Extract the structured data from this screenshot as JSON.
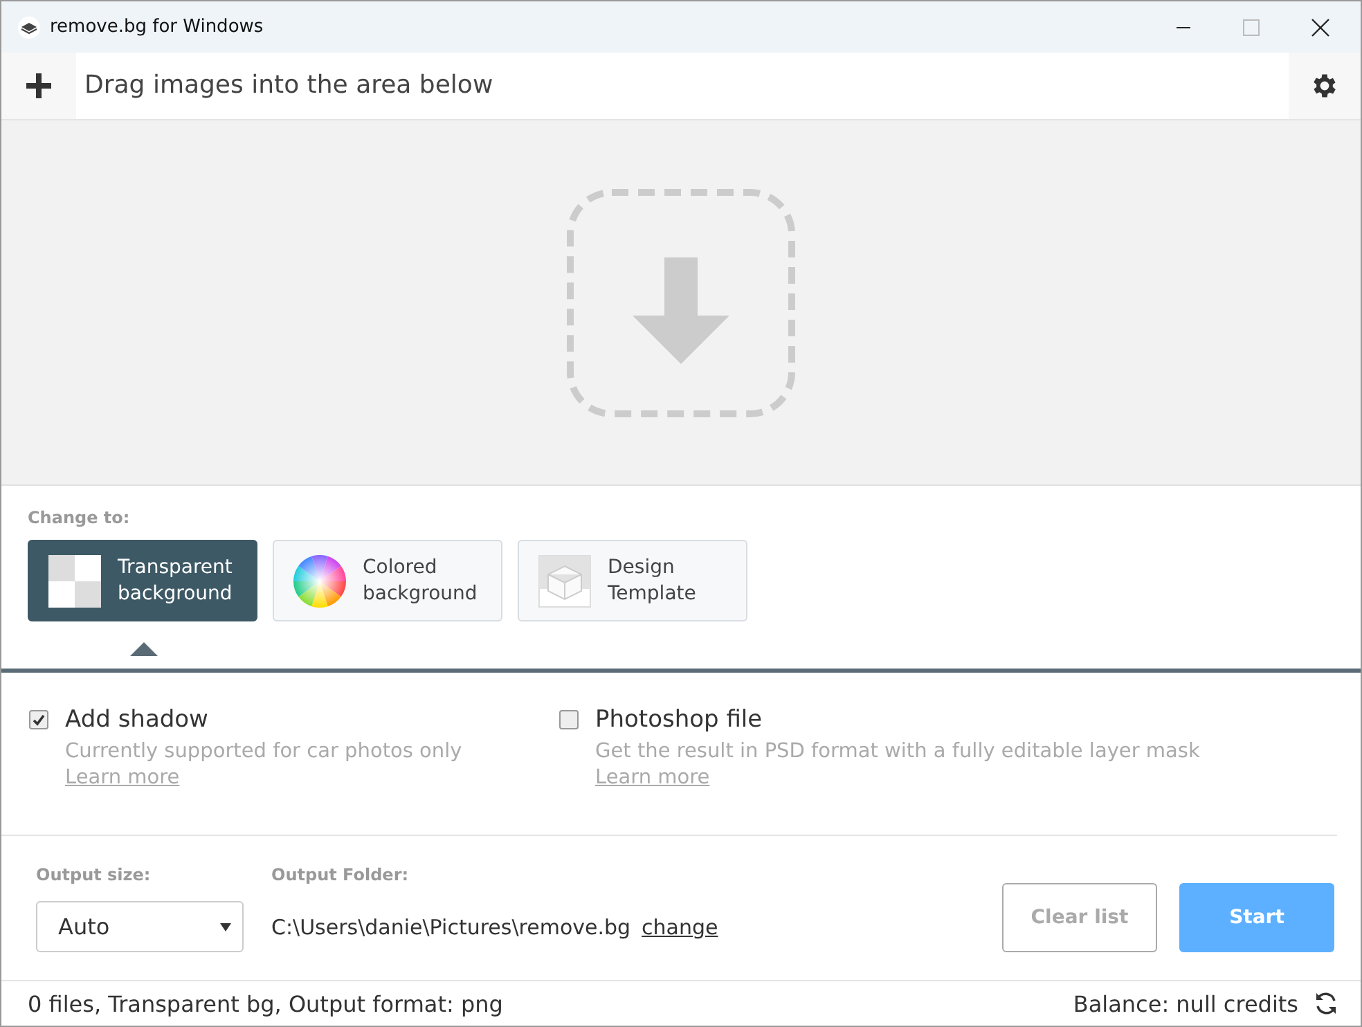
{
  "window": {
    "title": "remove.bg for Windows"
  },
  "toolbar": {
    "hint": "Drag images into the area below"
  },
  "change_to": {
    "label": "Change to:",
    "options": [
      {
        "kind": "checker",
        "label": "Transparent background",
        "selected": true
      },
      {
        "kind": "wheel",
        "label": "Colored background",
        "selected": false
      },
      {
        "kind": "cube",
        "label": "Design Template",
        "selected": false
      }
    ]
  },
  "options": [
    {
      "label": "Add shadow",
      "checked": true,
      "description": "Currently supported for car photos only",
      "link": "Learn more"
    },
    {
      "label": "Photoshop file",
      "checked": false,
      "description": "Get the result in PSD format with a fully editable layer mask",
      "link": "Learn more"
    }
  ],
  "output": {
    "size_label": "Output size:",
    "size_value": "Auto",
    "folder_label": "Output Folder:",
    "folder": "C:\\Users\\danie\\Pictures\\remove.bg",
    "change_link": "change"
  },
  "buttons": [
    {
      "kind": "secondary",
      "label": "Clear list"
    },
    {
      "kind": "primary",
      "label": "Start"
    }
  ],
  "status_bar": {
    "summary": "0 files, Transparent bg, Output format: png",
    "balance": "Balance: null credits"
  }
}
